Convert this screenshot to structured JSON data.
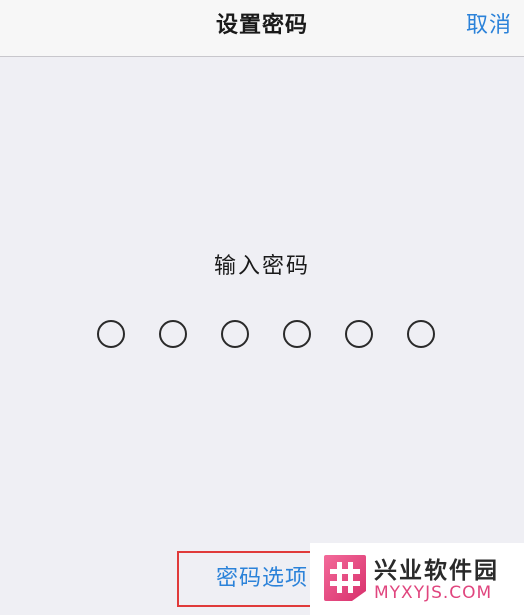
{
  "nav": {
    "title": "设置密码",
    "cancel_label": "取消"
  },
  "passcode": {
    "prompt": "输入密码",
    "digits_total": 6,
    "digits_entered": 0
  },
  "footer": {
    "options_label": "密码选项"
  },
  "watermark": {
    "name": "兴业软件园",
    "domain": "MYXYJS.COM"
  },
  "colors": {
    "accent": "#2b82d9",
    "highlight_frame": "#e03a3a",
    "watermark_pink": "#e0457e"
  }
}
